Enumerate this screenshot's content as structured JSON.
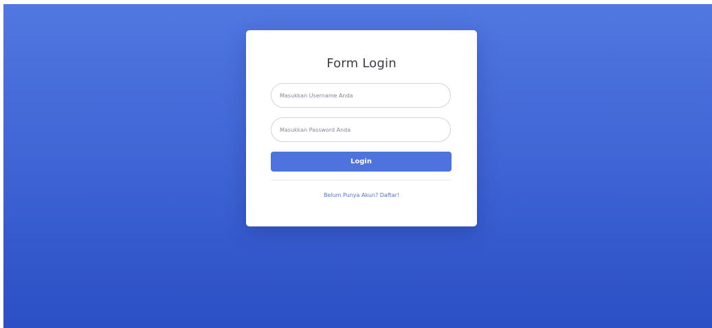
{
  "login_form": {
    "title": "Form Login",
    "username_placeholder": "Masukkan Username Anda",
    "password_placeholder": "Masukkan Password Anda",
    "login_label": "Login",
    "register_link": "Belum Punya Akun? Daftar!"
  },
  "colors": {
    "background_top": "#5177e0",
    "background_bottom": "#2b4fc4",
    "primary": "#4e73df",
    "card": "#ffffff"
  }
}
